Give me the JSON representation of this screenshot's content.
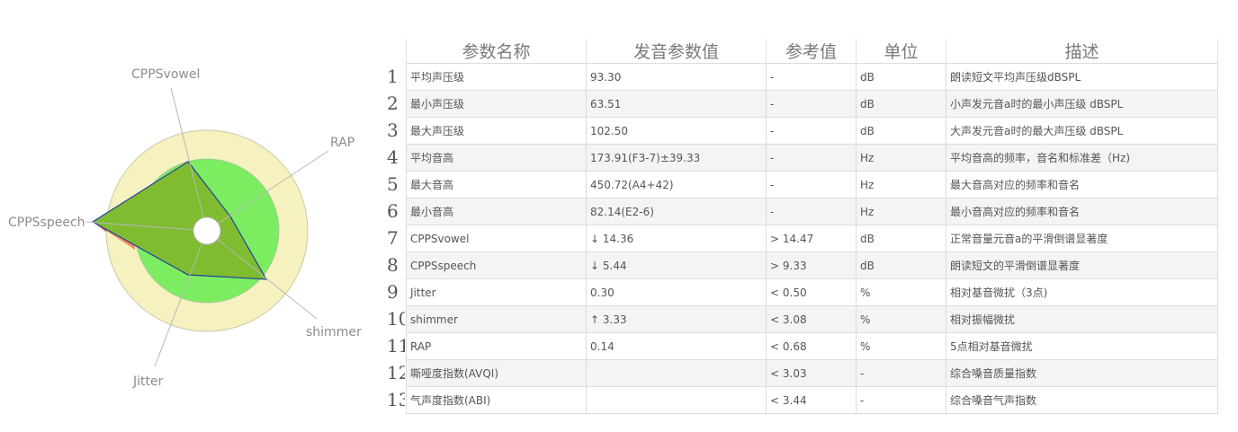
{
  "radar": {
    "axes": [
      {
        "label": "CPPSvowel"
      },
      {
        "label": "RAP"
      },
      {
        "label": "shimmer"
      },
      {
        "label": "Jitter"
      },
      {
        "label": "CPPSspeech"
      }
    ],
    "colors": {
      "outer_ring": "#f5f2bf",
      "inner_ring": "#7ced60",
      "value_fill": "#80bc30",
      "overflow_orange": "#f59060",
      "overflow_red": "#d0102a",
      "outline": "#2040a0",
      "axis_line": "#b8b8b8"
    }
  },
  "table": {
    "headers": [
      "参数名称",
      "发音参数值",
      "参考值",
      "单位",
      "描述"
    ],
    "row_numbers": [
      "1",
      "2",
      "3",
      "4",
      "5",
      "6",
      "7",
      "8",
      "9",
      "10",
      "11",
      "12",
      "13"
    ],
    "rows": [
      [
        "平均声压级",
        "93.30",
        "-",
        "dB",
        "朗读短文平均声压级dBSPL"
      ],
      [
        "最小声压级",
        "63.51",
        "-",
        "dB",
        "小声发元音a时的最小声压级 dBSPL"
      ],
      [
        "最大声压级",
        "102.50",
        "-",
        "dB",
        "大声发元音a时的最大声压级 dBSPL"
      ],
      [
        "平均音高",
        "173.91(F3-7)±39.33",
        "-",
        "Hz",
        "平均音高的频率，音名和标准差（Hz)"
      ],
      [
        "最大音高",
        "450.72(A4+42)",
        "-",
        "Hz",
        "最大音高对应的频率和音名"
      ],
      [
        "最小音高",
        "82.14(E2-6)",
        "-",
        "Hz",
        "最小音高对应的频率和音名"
      ],
      [
        "CPPSvowel",
        "↓ 14.36",
        "> 14.47",
        "dB",
        "正常音量元音a的平滑倒谱显著度"
      ],
      [
        "CPPSspeech",
        "↓ 5.44",
        "> 9.33",
        "dB",
        "朗读短文的平滑倒谱显著度"
      ],
      [
        "Jitter",
        "0.30",
        "< 0.50",
        "%",
        "相对基音微扰（3点)"
      ],
      [
        "shimmer",
        "↑ 3.33",
        "< 3.08",
        "%",
        "相对振幅微扰"
      ],
      [
        "RAP",
        "0.14",
        "< 0.68",
        "%",
        "5点相对基音微扰"
      ],
      [
        "嘶哑度指数(AVQI)",
        "",
        "< 3.03",
        "-",
        "综合嗓音质量指数"
      ],
      [
        "气声度指数(ABI)",
        "",
        "< 3.44",
        "-",
        "综合嗓音气声指数"
      ]
    ]
  }
}
